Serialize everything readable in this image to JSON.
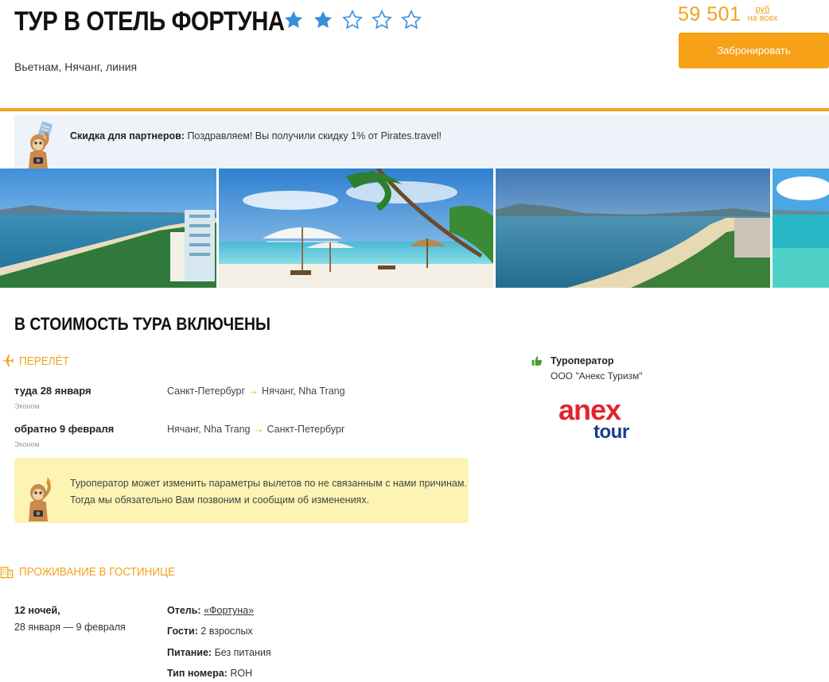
{
  "header": {
    "title": "Тур в отель Фортуна",
    "rating": {
      "filled": 2,
      "total": 5
    },
    "location": "Вьетнам, Нячанг, линия",
    "price": "59 501",
    "price_currency": "руб",
    "price_note": "на всех",
    "book_label": "Забронировать"
  },
  "partner": {
    "label": "Скидка для партнеров:",
    "text": "Поздравляем! Вы получили скидку 1% от Pirates.travel!"
  },
  "gallery": {
    "photos": [
      "coast-city-photo",
      "beach-umbrellas-photo",
      "bay-panorama-photo",
      "lagoon-photo"
    ]
  },
  "included": {
    "title": "В стоимость тура включены",
    "flight": {
      "heading": "Перелёт",
      "legs": [
        {
          "date": "туда 28 января",
          "class": "Эконом",
          "from": "Санкт-Петербург",
          "arrow": "→",
          "to": "Нячанг, Nha Trang"
        },
        {
          "date": "обратно 9 февраля",
          "class": "Эконом",
          "from": "Нячанг, Nha Trang",
          "arrow": "→",
          "to": "Санкт-Петербург"
        }
      ],
      "notice_line1": "Туроператор может изменить параметры вылетов по не связанным с нами причинам.",
      "notice_line2": "Тогда мы обязательно Вам позвоним и сообщим об изменениях."
    },
    "operator": {
      "label": "Туроператор",
      "name": "ООО \"Анекс Туризм\"",
      "logo_top": "anex",
      "logo_bottom": "tour"
    },
    "stay": {
      "heading": "Проживание в гостинице",
      "nights": "12 ночей,",
      "dates": "28 января — 9 февраля",
      "hotel_label": "Отель:",
      "hotel_value": "«Фортуна»",
      "guests_label": "Гости:",
      "guests_value": "2 взрослых",
      "meal_label": "Питание:",
      "meal_value": "Без питания",
      "room_label": "Тип номера:",
      "room_value": "ROH"
    }
  },
  "colors": {
    "accent": "#f2a21b",
    "star": "#3a8fd9",
    "notice_bg": "#fdf4b3",
    "partner_bg": "#eef3f9",
    "anex_red": "#e4242b",
    "anex_blue": "#1a3c8f"
  }
}
